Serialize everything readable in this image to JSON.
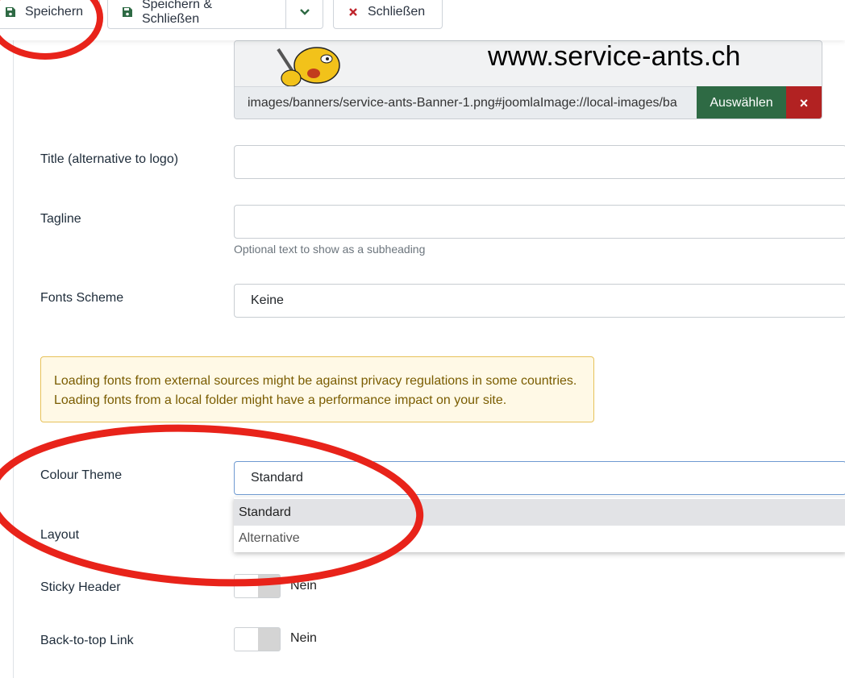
{
  "toolbar": {
    "save_label": "Speichern",
    "save_close_label": "Speichern & Schließen",
    "close_label": "Schließen"
  },
  "logo": {
    "banner_text": "www.service-ants.ch",
    "path_value": "images/banners/service-ants-Banner-1.png#joomlaImage://local-images/ba",
    "select_label": "Auswählen",
    "clear_label": "×"
  },
  "fields": {
    "title_label": "Title (alternative to logo)",
    "title_value": "",
    "tagline_label": "Tagline",
    "tagline_value": "",
    "tagline_hint": "Optional text to show as a subheading",
    "fonts_label": "Fonts Scheme",
    "fonts_value": "Keine",
    "alert_line1": "Loading fonts from external sources might be against privacy regulations in some countries.",
    "alert_line2": "Loading fonts from a local folder might have a performance impact on your site.",
    "colour_label": "Colour Theme",
    "colour_value": "Standard",
    "colour_options": [
      "Standard",
      "Alternative"
    ],
    "layout_label": "Layout",
    "sticky_label": "Sticky Header",
    "sticky_value": "Nein",
    "backtotop_label": "Back-to-top Link",
    "backtotop_value": "Nein"
  },
  "colors": {
    "select_button": "#2e6a44",
    "clear_button": "#b22222",
    "annotation": "#e8231a",
    "alert_border": "#e7c25a"
  }
}
